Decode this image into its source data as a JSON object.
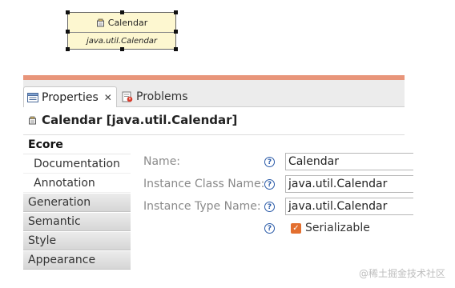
{
  "diagram": {
    "node_name": "Calendar",
    "node_type": "java.util.Calendar"
  },
  "view": {
    "tabs": [
      {
        "label": "Properties",
        "icon": "properties-icon",
        "active": true
      },
      {
        "label": "Problems",
        "icon": "problems-icon",
        "active": false
      }
    ],
    "title": "Calendar [java.util.Calendar]",
    "sections": [
      {
        "label": "Ecore",
        "state": "active"
      },
      {
        "label": "Documentation",
        "state": "sub"
      },
      {
        "label": "Annotation",
        "state": "sub"
      },
      {
        "label": "Generation",
        "state": "normal"
      },
      {
        "label": "Semantic",
        "state": "normal"
      },
      {
        "label": "Style",
        "state": "normal"
      },
      {
        "label": "Appearance",
        "state": "normal"
      }
    ]
  },
  "form": {
    "name_label": "Name:",
    "name_value": "Calendar",
    "instance_class_label": "Instance Class Name:",
    "instance_class_value": "java.util.Calendar",
    "instance_type_label": "Instance Type Name:",
    "instance_type_value": "java.util.Calendar",
    "help_glyph": "?",
    "serializable_label": "Serializable",
    "serializable_checked": true
  },
  "watermark": "@稀土掘金技术社区",
  "colors": {
    "accent_bar": "#e8957a",
    "checkbox": "#e36f2f",
    "help_icon": "#2a5aa8",
    "node_fill": "#fdf7d0"
  }
}
